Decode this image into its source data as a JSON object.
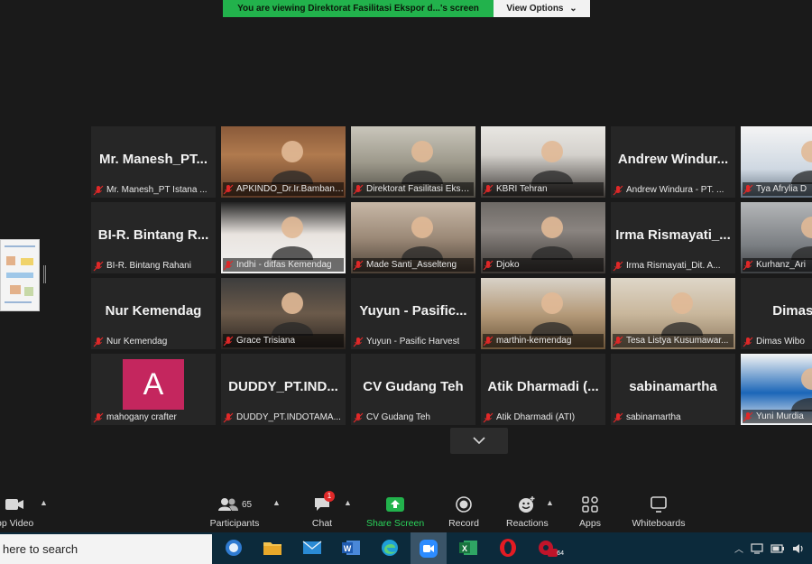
{
  "banner": {
    "viewing_text": "You are viewing Direktorat Fasilitasi Ekspor d...'s screen",
    "options_label": "View Options",
    "options_caret": "⌄"
  },
  "tiles": [
    {
      "name": "Mr.  Manesh_PT...",
      "label": "Mr. Manesh_PT Istana ...",
      "kind": "name"
    },
    {
      "name": "",
      "label": "APKINDO_Dr.Ir.Bambang ...",
      "kind": "video"
    },
    {
      "name": "",
      "label": "Direktorat Fasilitasi Ekspo...",
      "kind": "video"
    },
    {
      "name": "",
      "label": "KBRI Tehran",
      "kind": "video"
    },
    {
      "name": "Andrew  Windur...",
      "label": "Andrew Windura - PT. ...",
      "kind": "name"
    },
    {
      "name": "",
      "label": "Tya Afrylia D",
      "kind": "video"
    },
    {
      "name": "BI-R.  Bintang  R...",
      "label": "BI-R. Bintang Rahani",
      "kind": "name"
    },
    {
      "name": "",
      "label": "Indhi - ditfas Kemendag",
      "kind": "video"
    },
    {
      "name": "",
      "label": "Made Santi_Asselteng",
      "kind": "video"
    },
    {
      "name": "",
      "label": "Djoko",
      "kind": "video"
    },
    {
      "name": "Irma  Rismayati_...",
      "label": "Irma Rismayati_Dit. A...",
      "kind": "name"
    },
    {
      "name": "",
      "label": "Kurhanz_Ari",
      "kind": "video"
    },
    {
      "name": "Nur Kemendag",
      "label": "Nur Kemendag",
      "kind": "name"
    },
    {
      "name": "",
      "label": "Grace Trisiana",
      "kind": "video"
    },
    {
      "name": "Yuyun  -  Pasific...",
      "label": "Yuyun - Pasific Harvest",
      "kind": "name"
    },
    {
      "name": "",
      "label": "marthin-kemendag",
      "kind": "video"
    },
    {
      "name": "",
      "label": "Tesa Listya Kusumawar...",
      "kind": "video"
    },
    {
      "name": "Dimas  Wi",
      "label": "Dimas Wibo",
      "kind": "name"
    },
    {
      "name": "",
      "label": "mahogany crafter",
      "kind": "avatar",
      "avatar_letter": "A"
    },
    {
      "name": "DUDDY_PT.IND...",
      "label": "DUDDY_PT.INDOTAMA...",
      "kind": "name"
    },
    {
      "name": "CV Gudang Teh",
      "label": "CV Gudang Teh",
      "kind": "name"
    },
    {
      "name": "Atik  Dharmadi  (...",
      "label": "Atik Dharmadi (ATI)",
      "kind": "name"
    },
    {
      "name": "sabinamartha",
      "label": "sabinamartha",
      "kind": "name"
    },
    {
      "name": "",
      "label": "Yuni Murdia",
      "kind": "video"
    }
  ],
  "toolbar": {
    "stop_video": "op Video",
    "participants": "Participants",
    "participants_count": "65",
    "chat": "Chat",
    "chat_badge": "1",
    "share_screen": "Share Screen",
    "record": "Record",
    "reactions": "Reactions",
    "apps": "Apps",
    "whiteboards": "Whiteboards"
  },
  "taskbar": {
    "search_text": "here to search",
    "opera_badge": "64"
  },
  "colors": {
    "share_green": "#22b24c",
    "active_speaker": "#b9e13a",
    "mic_muted": "#e02828",
    "taskbar": "#0c2a3b"
  }
}
